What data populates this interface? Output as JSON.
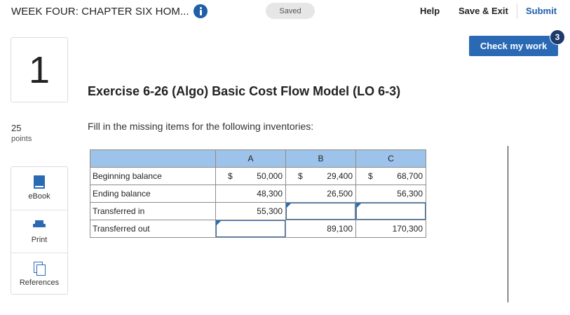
{
  "header": {
    "title": "WEEK FOUR: CHAPTER SIX HOM...",
    "saved": "Saved",
    "help": "Help",
    "save_exit": "Save & Exit",
    "submit": "Submit"
  },
  "question": {
    "number": "1",
    "points_value": "25",
    "points_label": "points",
    "title": "Exercise 6-26 (Algo) Basic Cost Flow Model (LO 6-3)",
    "instructions": "Fill in the missing items for the following inventories:"
  },
  "actions": {
    "check_my_work": "Check my work",
    "attempts_badge": "3"
  },
  "tools": {
    "ebook": "eBook",
    "print": "Print",
    "references": "References"
  },
  "table": {
    "columns": [
      "A",
      "B",
      "C"
    ],
    "currency": "$",
    "rows": [
      {
        "label": "Beginning balance",
        "a": "50,000",
        "b": "29,400",
        "c": "68,700"
      },
      {
        "label": "Ending balance",
        "a": "48,300",
        "b": "26,500",
        "c": "56,300"
      },
      {
        "label": "Transferred in",
        "a": "55,300",
        "b": "",
        "c": ""
      },
      {
        "label": "Transferred out",
        "a": "",
        "b": "89,100",
        "c": "170,300"
      }
    ]
  },
  "colors": {
    "accent": "#2a6ab5",
    "header_fill": "#9ec3ea",
    "badge": "#1c3a6b"
  },
  "icons": [
    "info-icon",
    "ebook-icon",
    "print-icon",
    "references-icon"
  ]
}
